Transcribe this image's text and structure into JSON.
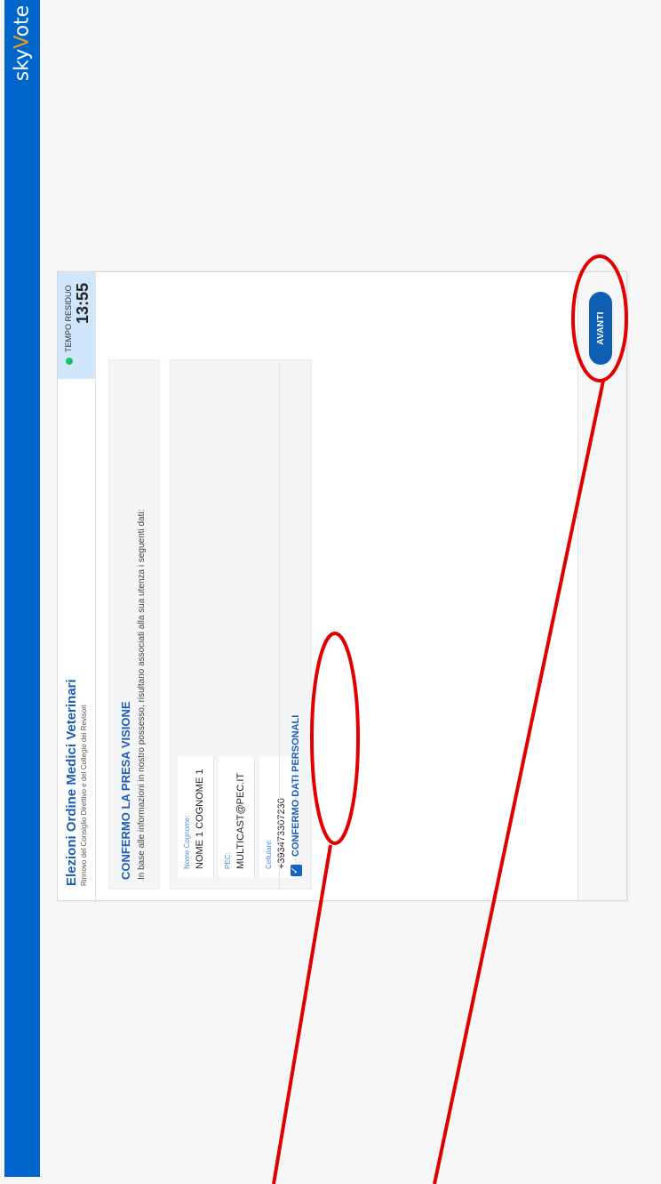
{
  "brand": {
    "logo_prefix": "sky",
    "logo_v": "V",
    "logo_suffix": "ote"
  },
  "header": {
    "title": "Elezioni Ordine Medici Veterinari",
    "subtitle": "Rinnovo del Consiglio Direttivo e del Collegio dei Revisori"
  },
  "timer": {
    "label": "TEMPO RESIDUO",
    "time": "13:55"
  },
  "notice": {
    "heading": "CONFERMO LA PRESA VISIONE",
    "text": "In base alle informazioni in nostro possesso, risultano associati alla sua utenza i seguenti dati:"
  },
  "fields": [
    {
      "label": "Nome Cognome:",
      "value": "NOME 1 COGNOME 1"
    },
    {
      "label": "PEC:",
      "value": "MULTICAST@PEC.IT"
    },
    {
      "label": "Cellulare:",
      "value": "+393473307230"
    }
  ],
  "confirm": {
    "label": "CONFERMO DATI PERSONALI",
    "checked": true
  },
  "footer": {
    "next_label": "AVANTI"
  },
  "colors": {
    "primary": "#0066cc",
    "accent": "#f39c12",
    "timer_bg": "#cfe6fb",
    "annotation": "#e00000"
  }
}
